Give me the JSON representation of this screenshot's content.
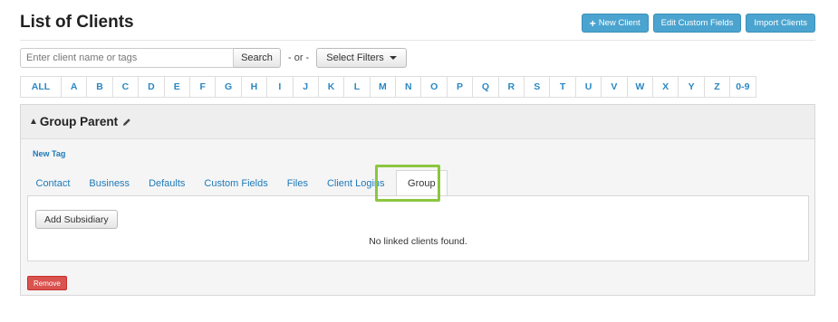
{
  "header": {
    "title": "List of Clients",
    "buttons": {
      "new_client": "New Client",
      "edit_custom_fields": "Edit Custom Fields",
      "import_clients": "Import Clients"
    }
  },
  "search": {
    "placeholder": "Enter client name or tags",
    "search_label": "Search",
    "or_text": "- or -",
    "filters_label": "Select Filters"
  },
  "alphabet": [
    "ALL",
    "A",
    "B",
    "C",
    "D",
    "E",
    "F",
    "G",
    "H",
    "I",
    "J",
    "K",
    "L",
    "M",
    "N",
    "O",
    "P",
    "Q",
    "R",
    "S",
    "T",
    "U",
    "V",
    "W",
    "X",
    "Y",
    "Z",
    "0-9"
  ],
  "group": {
    "title": "Group Parent",
    "new_tag": "New Tag",
    "tabs": [
      "Contact",
      "Business",
      "Defaults",
      "Custom Fields",
      "Files",
      "Client Logins",
      "Group"
    ],
    "active_tab": "Group",
    "add_subsidiary": "Add Subsidiary",
    "empty_message": "No linked clients found.",
    "remove_label": "Remove"
  },
  "colors": {
    "accent": "#4ba4cf",
    "link": "#1e7ab8",
    "danger": "#d9534f",
    "highlight": "#8cc63f"
  },
  "icons": {
    "add": "plus-icon",
    "edit": "pencil-icon",
    "collapse": "chevron-up-icon",
    "dropdown": "caret-down-icon"
  }
}
